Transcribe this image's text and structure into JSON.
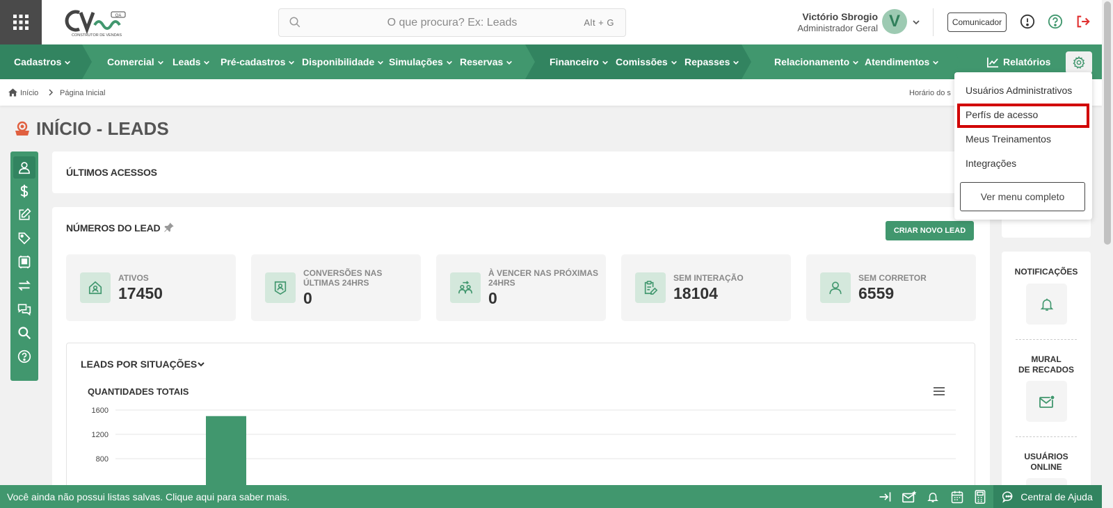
{
  "header": {
    "logo_text": "CV",
    "logo_badge": "QA",
    "logo_sub": "CONSTRUTOR DE VENDAS",
    "search_placeholder": "O que procura? Ex: Leads",
    "search_shortcut": "Alt + G",
    "user_name": "Victório Sbrogio",
    "user_role": "Administrador Geral",
    "avatar_initial": "V",
    "comunicador_label": "Comunicador",
    "icons": [
      "apps-grid-icon",
      "search-icon",
      "info-icon",
      "help-icon",
      "logout-icon",
      "chevron-down-icon"
    ]
  },
  "nav": {
    "items": [
      "Cadastros",
      "Comercial",
      "Leads",
      "Pré-cadastros",
      "Disponibilidade",
      "Simulações",
      "Reservas",
      "Financeiro",
      "Comissões",
      "Repasses",
      "Relacionamento",
      "Atendimentos"
    ],
    "reports": "Relatórios"
  },
  "breadcrumb": {
    "home": "Início",
    "current": "Página Inicial",
    "right_text": "Horário do s"
  },
  "page_title": "INÍCIO - LEADS",
  "sidebar_tools": [
    "user-icon",
    "dollar-icon",
    "edit-icon",
    "tag-icon",
    "cart-icon",
    "swap-icon",
    "chat-icon",
    "search-icon",
    "help-icon"
  ],
  "last_access": {
    "title": "ÚLTIMOS ACESSOS"
  },
  "lead_numbers": {
    "title": "NÚMEROS DO LEAD",
    "create_button": "CRIAR NOVO LEAD",
    "stats": [
      {
        "label": "ATIVOS",
        "value": "17450",
        "icon": "house-user-icon"
      },
      {
        "label": "CONVERSÕES NAS ÚLTIMAS 24hrs",
        "value": "0",
        "icon": "badge-user-icon"
      },
      {
        "label": "À VENCER NAS PRÓXIMAS 24hrs",
        "value": "0",
        "icon": "users-arrows-icon"
      },
      {
        "label": "SEM INTERAÇÃO",
        "value": "18104",
        "icon": "clipboard-edit-icon"
      },
      {
        "label": "SEM CORRETOR",
        "value": "6559",
        "icon": "user-icon"
      }
    ]
  },
  "leads_situacoes": {
    "title": "LEADS POR SITUAÇÕES",
    "chart_title": "QUANTIDADES TOTAIS"
  },
  "chart_data": {
    "type": "bar",
    "title": "QUANTIDADES TOTAIS",
    "yticks": [
      1600,
      1200,
      800
    ],
    "ylim": [
      0,
      1600
    ],
    "values": [
      1500
    ],
    "grid": true
  },
  "right_panel": {
    "notifications": "NOTIFICAÇÕES",
    "mural_line1": "MURAL",
    "mural_line2": "DE RECADOS",
    "online_line1": "USUÁRIOS",
    "online_line2": "ONLINE"
  },
  "settings_menu": {
    "items": [
      "Usuários Administrativos",
      "Perfís de acesso",
      "Meus Treinamentos",
      "Integrações"
    ],
    "highlighted": "Perfís de acesso",
    "full_menu_button": "Ver menu completo"
  },
  "bottom_bar": {
    "message": "Você ainda não possui listas salvas. Clique aqui para saber mais.",
    "help": "Central de Ajuda"
  },
  "colors": {
    "primary": "#41976e",
    "primary_dark": "#328460",
    "danger": "#d10000"
  }
}
